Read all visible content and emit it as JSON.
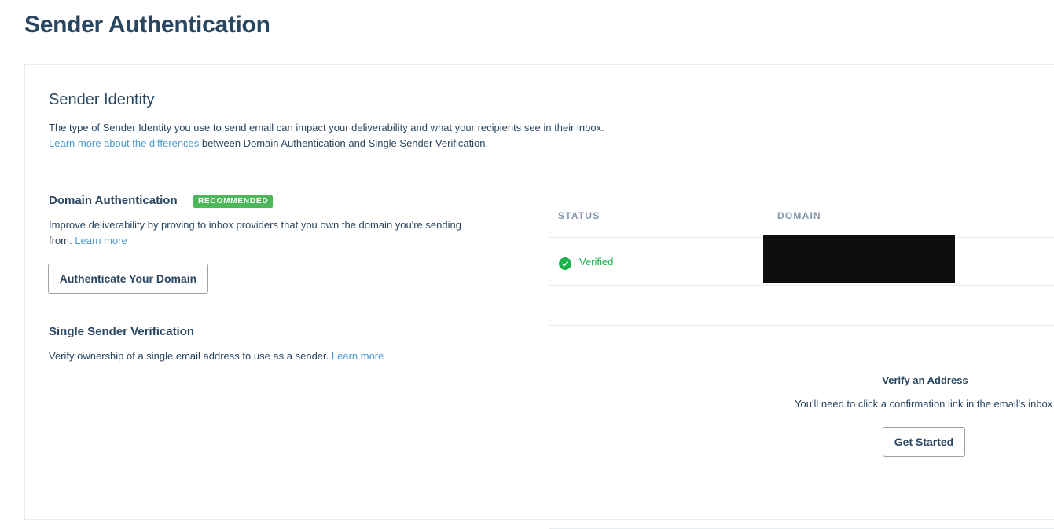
{
  "page": {
    "title": "Sender Authentication"
  },
  "sender_identity": {
    "title": "Sender Identity",
    "description": "The type of Sender Identity you use to send email can impact your deliverability and what your recipients see in their inbox.",
    "learn_link": "Learn more about the differences",
    "learn_suffix": " between Domain Authentication and Single Sender Verification."
  },
  "domain_auth": {
    "title": "Domain Authentication",
    "badge": "RECOMMENDED",
    "description": "Improve deliverability by proving to inbox providers that you own the domain you're sending from.",
    "learn_more": "Learn more",
    "button": "Authenticate Your Domain",
    "table": {
      "headers": [
        "STATUS",
        "DOMAIN"
      ],
      "rows": [
        {
          "status": "Verified",
          "domain": ""
        }
      ]
    }
  },
  "single_sender": {
    "title": "Single Sender Verification",
    "description": "Verify ownership of a single email address to use as a sender.",
    "learn_more": "Learn more",
    "verify_title": "Verify an Address",
    "verify_text": "You'll need to click a confirmation link in the email's inbox.",
    "button": "Get Started"
  },
  "colors": {
    "heading": "#294661",
    "link": "#4a9bd1",
    "success": "#1cb14b",
    "badge": "#4db85a",
    "muted": "#8696a6"
  },
  "icons": {
    "status": "check-circle-icon"
  }
}
